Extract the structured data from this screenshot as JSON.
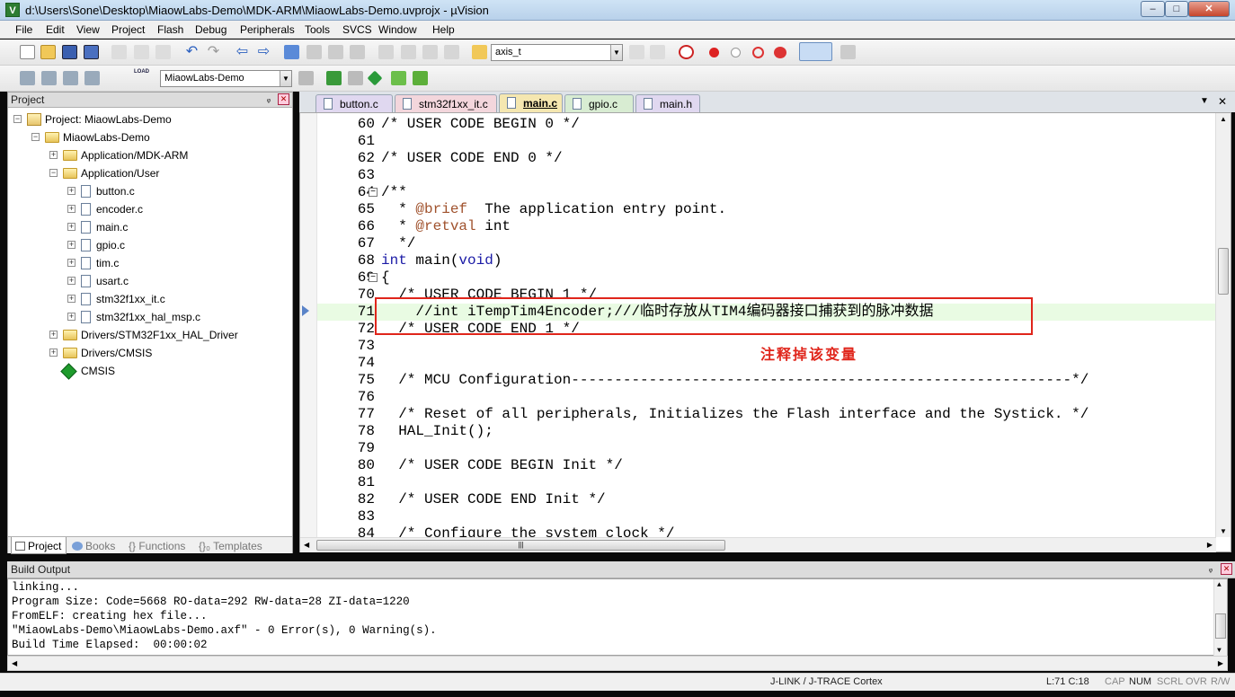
{
  "window": {
    "title": "d:\\Users\\Sone\\Desktop\\MiaowLabs-Demo\\MDK-ARM\\MiaowLabs-Demo.uvprojx - µVision",
    "app_icon": "V",
    "controls": {
      "minimize": "–",
      "maximize": "□",
      "close": "✕"
    }
  },
  "menu": [
    "File",
    "Edit",
    "View",
    "Project",
    "Flash",
    "Debug",
    "Peripherals",
    "Tools",
    "SVCS",
    "Window",
    "Help"
  ],
  "toolbar1": {
    "find_combo": "axis_t"
  },
  "toolbar2": {
    "target_combo": "MiaowLabs-Demo",
    "load_label": "LOAD"
  },
  "project_panel": {
    "title": "Project",
    "pin": "ᵩ",
    "close": "✕",
    "tree": [
      {
        "label": "Project: MiaowLabs-Demo",
        "type": "project",
        "exp": "−"
      },
      {
        "label": "MiaowLabs-Demo",
        "type": "folder",
        "exp": "−"
      },
      {
        "label": "Application/MDK-ARM",
        "type": "folder",
        "exp": "+"
      },
      {
        "label": "Application/User",
        "type": "folder",
        "exp": "−"
      },
      {
        "label": "button.c",
        "type": "file",
        "exp": "+"
      },
      {
        "label": "encoder.c",
        "type": "file",
        "exp": "+"
      },
      {
        "label": "main.c",
        "type": "file",
        "exp": "+"
      },
      {
        "label": "gpio.c",
        "type": "file",
        "exp": "+"
      },
      {
        "label": "tim.c",
        "type": "file",
        "exp": "+"
      },
      {
        "label": "usart.c",
        "type": "file",
        "exp": "+"
      },
      {
        "label": "stm32f1xx_it.c",
        "type": "file",
        "exp": "+"
      },
      {
        "label": "stm32f1xx_hal_msp.c",
        "type": "file",
        "exp": "+"
      },
      {
        "label": "Drivers/STM32F1xx_HAL_Driver",
        "type": "folder",
        "exp": "+"
      },
      {
        "label": "Drivers/CMSIS",
        "type": "folder",
        "exp": "+"
      },
      {
        "label": "CMSIS",
        "type": "cmsis",
        "exp": ""
      }
    ],
    "tabs": [
      "Project",
      "Books",
      "{} Functions",
      "{}₀ Templates"
    ]
  },
  "editor": {
    "tabs": [
      {
        "label": "button.c",
        "color": "#e0d8f0"
      },
      {
        "label": "stm32f1xx_it.c",
        "color": "#f3d6dc"
      },
      {
        "label": "main.c",
        "color": "#f5e7b0"
      },
      {
        "label": "gpio.c",
        "color": "#d8ecd2"
      },
      {
        "label": "main.h",
        "color": "#e0d8f0"
      }
    ],
    "tab_controls": {
      "dropdown": "▼",
      "close": "✕"
    },
    "lines": [
      {
        "n": "60",
        "t": "/* USER CODE BEGIN 0 */",
        "c": "cmt",
        "fold": ""
      },
      {
        "n": "61",
        "t": "",
        "c": "",
        "fold": ""
      },
      {
        "n": "62",
        "t": "/* USER CODE END 0 */",
        "c": "cmt",
        "fold": ""
      },
      {
        "n": "63",
        "t": "",
        "c": "",
        "fold": ""
      },
      {
        "n": "64",
        "t": "/**",
        "c": "cmt",
        "fold": "−"
      },
      {
        "n": "65",
        "t": "  * @brief  The application entry point.",
        "c": "doc",
        "fold": ""
      },
      {
        "n": "66",
        "t": "  * @retval int",
        "c": "doc",
        "fold": ""
      },
      {
        "n": "67",
        "t": "  */",
        "c": "cmt",
        "fold": ""
      },
      {
        "n": "68",
        "t": "int main(void)",
        "c": "kw",
        "fold": ""
      },
      {
        "n": "69",
        "t": "{",
        "c": "",
        "fold": "−"
      },
      {
        "n": "70",
        "t": "  /* USER CODE BEGIN 1 */",
        "c": "cmt",
        "fold": ""
      },
      {
        "n": "71",
        "t": "    //int iTempTim4Encoder;///临时存放从TIM4编码器接口捕获到的脉冲数据",
        "c": "cmt",
        "fold": ""
      },
      {
        "n": "72",
        "t": "  /* USER CODE END 1 */",
        "c": "cmt",
        "fold": ""
      },
      {
        "n": "73",
        "t": "",
        "c": "",
        "fold": ""
      },
      {
        "n": "74",
        "t": "",
        "c": "",
        "fold": ""
      },
      {
        "n": "75",
        "t": "  /* MCU Configuration----------------------------------------------------------*/",
        "c": "cmt",
        "fold": ""
      },
      {
        "n": "76",
        "t": "",
        "c": "",
        "fold": ""
      },
      {
        "n": "77",
        "t": "  /* Reset of all peripherals, Initializes the Flash interface and the Systick. */",
        "c": "cmt",
        "fold": ""
      },
      {
        "n": "78",
        "t": "  HAL_Init();",
        "c": "",
        "fold": ""
      },
      {
        "n": "79",
        "t": "",
        "c": "",
        "fold": ""
      },
      {
        "n": "80",
        "t": "  /* USER CODE BEGIN Init */",
        "c": "cmt",
        "fold": ""
      },
      {
        "n": "81",
        "t": "",
        "c": "",
        "fold": ""
      },
      {
        "n": "82",
        "t": "  /* USER CODE END Init */",
        "c": "cmt",
        "fold": ""
      },
      {
        "n": "83",
        "t": "",
        "c": "",
        "fold": ""
      },
      {
        "n": "84",
        "t": "  /* Configure the system clock */",
        "c": "cmt",
        "fold": ""
      }
    ],
    "current_line": "71",
    "annotation": "注释掉该变量",
    "hscroll_grip": "|||"
  },
  "build_output": {
    "title": "Build Output",
    "lines": [
      "linking...",
      "Program Size: Code=5668 RO-data=292 RW-data=28 ZI-data=1220",
      "FromELF: creating hex file...",
      "\"MiaowLabs-Demo\\MiaowLabs-Demo.axf\" - 0 Error(s), 0 Warning(s).",
      "Build Time Elapsed:  00:00:02"
    ]
  },
  "status": {
    "debugger": "J-LINK / J-TRACE Cortex",
    "position": "L:71 C:18",
    "caps": "CAP",
    "num": "NUM",
    "scrl": "SCRL",
    "ovr": "OVR",
    "rw": "R/W"
  },
  "colors": {
    "comment": "#2e8b2e",
    "keyword": "#1a1aa6",
    "annotation": "#e0251b"
  }
}
